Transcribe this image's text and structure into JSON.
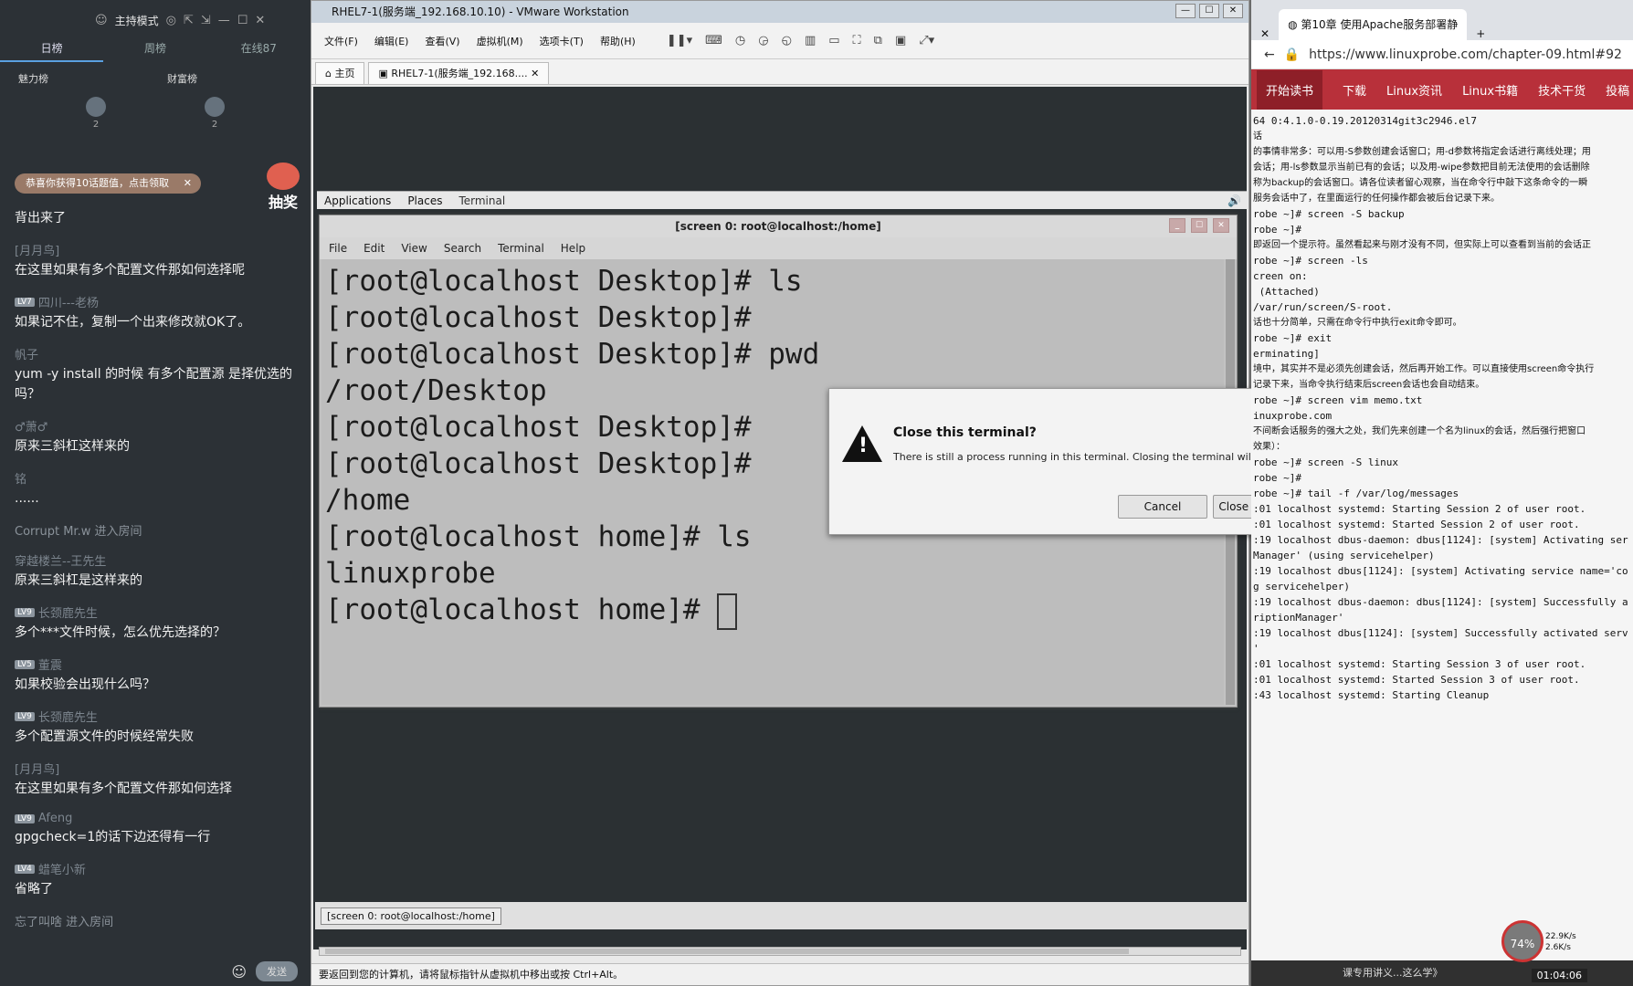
{
  "chat": {
    "header": {
      "mode": "主持模式"
    },
    "rank_tabs": [
      "日榜",
      "周榜",
      "在线87"
    ],
    "sub": [
      "魅力榜",
      "财富榜"
    ],
    "tops": [
      "2",
      "2"
    ],
    "toast": "恭喜你获得10话题值，点击领取",
    "lottery": "抽奖",
    "messages": [
      {
        "who": "",
        "text": "背出来了"
      },
      {
        "who": "[月月鸟]",
        "text": "在这里如果有多个配置文件那如何选择呢"
      },
      {
        "level": "LV7",
        "who": "四川---老杨",
        "text": "如果记不住，复制一个出来修改就OK了。"
      },
      {
        "who": "帆子",
        "text": "yum -y install 的时候 有多个配置源  是择优选的吗？"
      },
      {
        "who": "♂萧♂",
        "text": "原来三斜杠这样来的"
      },
      {
        "who": "铭",
        "text": "......"
      },
      {
        "sys": true,
        "who": "Corrupt Mr.w 进入房间",
        "text": ""
      },
      {
        "who": "穿越楼兰--王先生",
        "text": "原来三斜杠是这样来的"
      },
      {
        "level": "LV9",
        "who": "长颈鹿先生",
        "text": "多个***文件时候，怎么优先选择的？"
      },
      {
        "level": "LV5",
        "who": "董震",
        "text": "如果校验会出现什么吗？"
      },
      {
        "level": "LV9",
        "who": "长颈鹿先生",
        "text": "多个配置源文件的时候经常失败"
      },
      {
        "who": "[月月鸟]",
        "text": "在这里如果有多个配置文件那如何选择"
      },
      {
        "level": "LV9",
        "who": "Afeng",
        "text": "gpgcheck=1的话下边还得有一行"
      },
      {
        "level": "LV4",
        "who": "蜡笔小新",
        "text": "省略了"
      },
      {
        "sys": true,
        "who": "忘了叫啥 进入房间",
        "text": ""
      }
    ],
    "send_label": "发送"
  },
  "vm": {
    "title": "RHEL7-1(服务端_192.168.10.10) - VMware Workstation",
    "menu": [
      "文件(F)",
      "编辑(E)",
      "查看(V)",
      "虚拟机(M)",
      "选项卡(T)",
      "帮助(H)"
    ],
    "tabs": [
      "主页",
      "RHEL7-1(服务端_192.168...."
    ],
    "gnome": {
      "applications": "Applications",
      "places": "Places",
      "terminal": "Terminal"
    },
    "terminal": {
      "title": "[screen 0: root@localhost:/home]",
      "menu": [
        "File",
        "Edit",
        "View",
        "Search",
        "Terminal",
        "Help"
      ],
      "lines": [
        "[root@localhost Desktop]# ls",
        "[root@localhost Desktop]#",
        "[root@localhost Desktop]# pwd",
        "/root/Desktop",
        "[root@localhost Desktop]#",
        "[root@localhost Desktop]#",
        "/home",
        "[root@localhost home]# ls",
        "linuxprobe",
        "[root@localhost home]# "
      ]
    },
    "dialog": {
      "heading": "Close this terminal?",
      "body": "There is still a process running in this terminal. Closing the terminal will kill it.",
      "cancel": "Cancel",
      "close": "Close Terminal"
    },
    "taskbar_item": "[screen 0: root@localhost:/home]",
    "status": "要返回到您的计算机，请将鼠标指针从虚拟机中移出或按 Ctrl+Alt。"
  },
  "browser": {
    "tab_title": "第10章 使用Apache服务部署静",
    "url": "https://www.linuxprobe.com/chapter-09.html#92",
    "nav": [
      "开始读书",
      "下载",
      "Linux资讯",
      "Linux书籍",
      "技术干货",
      "投稿"
    ],
    "content": [
      {
        "mono": true,
        "t": "64 0:4.1.0-0.19.20120314git3c2946.el7"
      },
      {
        "t": "话"
      },
      {
        "t": "的事情非常多：可以用-S参数创建会话窗口；用-d参数将指定会话进行离线处理；用"
      },
      {
        "t": "会话；用-ls参数显示当前已有的会话；以及用-wipe参数把目前无法使用的会话删除"
      },
      {
        "t": "称为backup的会话窗口。请各位读者留心观察，当在命令行中敲下这条命令的一瞬"
      },
      {
        "t": "服务会话中了，在里面运行的任何操作都会被后台记录下来。"
      },
      {
        "mono": true,
        "t": "robe ~]# screen -S backup"
      },
      {
        "mono": true,
        "t": "robe ~]#"
      },
      {
        "t": "即返回一个提示符。虽然看起来与刚才没有不同，但实际上可以查看到当前的会话正"
      },
      {
        "mono": true,
        "t": "robe ~]# screen -ls"
      },
      {
        "mono": true,
        "t": "creen on:"
      },
      {
        "mono": true,
        "t": " (Attached)"
      },
      {
        "mono": true,
        "t": "/var/run/screen/S-root."
      },
      {
        "t": "话也十分简单，只需在命令行中执行exit命令即可。"
      },
      {
        "mono": true,
        "t": "robe ~]# exit"
      },
      {
        "mono": true,
        "t": "erminating]"
      },
      {
        "t": "境中，其实并不是必须先创建会话，然后再开始工作。可以直接使用screen命令执行"
      },
      {
        "t": "记录下来，当命令执行结束后screen会话也会自动结束。"
      },
      {
        "mono": true,
        "t": "robe ~]# screen vim memo.txt"
      },
      {
        "mono": true,
        "t": "inuxprobe.com"
      },
      {
        "t": "不间断会话服务的强大之处，我们先来创建一个名为linux的会话，然后强行把窗口"
      },
      {
        "t": "效果）："
      },
      {
        "mono": true,
        "t": "robe ~]# screen -S linux"
      },
      {
        "mono": true,
        "t": "robe ~]#"
      },
      {
        "mono": true,
        "t": "robe ~]# tail -f /var/log/messages"
      },
      {
        "mono": true,
        "t": ":01 localhost systemd: Starting Session 2 of user root."
      },
      {
        "mono": true,
        "t": ":01 localhost systemd: Started Session 2 of user root."
      },
      {
        "mono": true,
        "t": ":19 localhost dbus-daemon: dbus[1124]: [system] Activating ser"
      },
      {
        "mono": true,
        "t": "Manager' (using servicehelper)"
      },
      {
        "mono": true,
        "t": ":19 localhost dbus[1124]: [system] Activating service name='co"
      },
      {
        "mono": true,
        "t": "g servicehelper)"
      },
      {
        "mono": true,
        "t": ":19 localhost dbus-daemon: dbus[1124]: [system] Successfully a"
      },
      {
        "mono": true,
        "t": "riptionManager'"
      },
      {
        "mono": true,
        "t": ":19 localhost dbus[1124]: [system] Successfully activated serv"
      },
      {
        "mono": true,
        "t": "'"
      },
      {
        "mono": true,
        "t": ":01 localhost systemd: Starting Session 3 of user root."
      },
      {
        "mono": true,
        "t": ":01 localhost systemd: Started Session 3 of user root."
      },
      {
        "mono": true,
        "t": ":43 localhost systemd: Starting Cleanup "
      }
    ],
    "ring_pct": "74%",
    "net_up": "22.9K/s",
    "net_down": "2.6K/s",
    "clock": "01:04:06",
    "bottom_text": "课专用讲义...这么学》"
  }
}
